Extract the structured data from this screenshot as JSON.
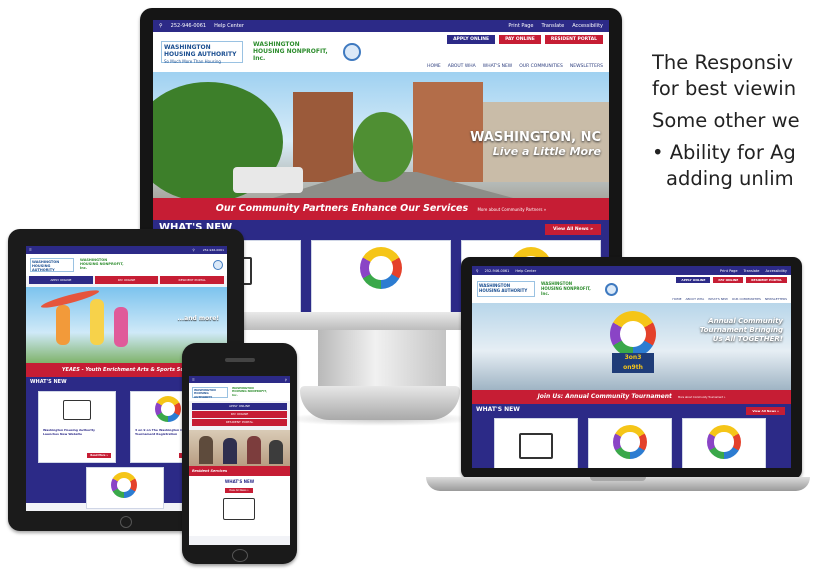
{
  "copy": {
    "line1": "The Responsiv",
    "line2": "for best viewin",
    "line3": "Some other we",
    "line4": "• Ability for Ag",
    "line5": "adding unlim"
  },
  "site": {
    "phone": "252-946-0061",
    "help_center": "Help Center",
    "print_page": "Print Page",
    "translate": "Translate",
    "accessibility": "Accessibility",
    "logo_wha_line1": "WASHINGTON",
    "logo_wha_line2": "HOUSING AUTHORITY",
    "logo_wha_tagline": "So Much More Than Housing",
    "logo_whn_line1": "WASHINGTON",
    "logo_whn_line2": "HOUSING NONPROFIT, Inc.",
    "apply_online": "APPLY ONLINE",
    "pay_online": "PAY ONLINE",
    "resident_portal": "RESIDENT PORTAL",
    "nav": [
      "HOME",
      "ABOUT WHA",
      "WHAT'S NEW",
      "OUR COMMUNITIES",
      "NEWSLETTERS"
    ],
    "hero_title": "WASHINGTON, NC",
    "hero_sub": "Live a Little More",
    "banner_text": "Our Community Partners Enhance Our Services",
    "banner_link": "More about Community Partners »",
    "whats_new": "WHAT'S NEW",
    "view_all": "View All News »"
  },
  "tablet": {
    "hero_text": "...and more!",
    "banner": "YEAES - Youth Enrichment Arts & Sports Supp",
    "whats_new": "WHAT'S NEW",
    "card1_title": "Washington Housing Authority Launches New Website",
    "card2_title": "3 on 9 on The Washington Community Tournament Registration",
    "read_more": "Read More »"
  },
  "laptop": {
    "hero_line1": "Annual Community",
    "hero_line2": "Tournament Bringing",
    "hero_line3": "Us All TOGETHER!",
    "banner": "Join Us: Annual Community Tournament",
    "banner_link": "More about Community Tournament »",
    "whats_new": "WHAT'S NEW",
    "view_all": "View All News »",
    "emblem_text1": "3on3",
    "emblem_text2": "on9th"
  },
  "phone": {
    "apply_online": "APPLY ONLINE",
    "pay_online": "PAY ONLINE",
    "resident_portal": "RESIDENT PORTAL",
    "banner": "Resident Services",
    "whats_new": "WHAT'S NEW",
    "view_all": "View All News »"
  },
  "colors": {
    "brand_navy": "#2c2a87",
    "brand_red": "#c61d34"
  }
}
